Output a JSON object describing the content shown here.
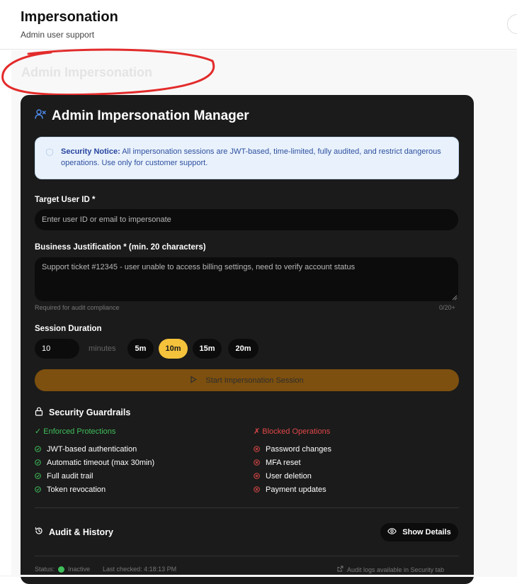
{
  "header": {
    "title": "Impersonation",
    "subtitle": "Admin user support"
  },
  "main": {
    "section_title": "Admin Impersonation"
  },
  "card": {
    "title": "Admin Impersonation Manager",
    "notice": {
      "label": "Security Notice:",
      "text": "All impersonation sessions are JWT-based, time-limited, fully audited, and restrict dangerous operations. Use only for customer support."
    },
    "target": {
      "label": "Target User ID *",
      "placeholder": "Enter user ID or email to impersonate",
      "value": ""
    },
    "justification": {
      "label": "Business Justification * (min. 20 characters)",
      "placeholder": "Support ticket #12345 - user unable to access billing settings, need to verify account status",
      "value": "",
      "hint": "Required for audit compliance",
      "counter": "0/20+"
    },
    "duration": {
      "label": "Session Duration",
      "value": "10",
      "unit": "minutes",
      "options": [
        "5m",
        "10m",
        "15m",
        "20m"
      ],
      "selected": "10m"
    },
    "start_button": "Start Impersonation Session",
    "guardrails": {
      "title": "Security Guardrails",
      "enforced_title": "✓ Enforced Protections",
      "enforced": [
        "JWT-based authentication",
        "Automatic timeout (max 30min)",
        "Full audit trail",
        "Token revocation"
      ],
      "blocked_title": "✗ Blocked Operations",
      "blocked": [
        "Password changes",
        "MFA reset",
        "User deletion",
        "Payment updates"
      ]
    },
    "audit": {
      "title": "Audit & History",
      "show_details": "Show Details"
    },
    "footer": {
      "status_label": "Status:",
      "status_value": "Inactive",
      "last_checked": "Last checked: 4:18:13 PM",
      "audit_link": "Audit logs available in Security tab"
    }
  },
  "colors": {
    "accent": "#f4c23b",
    "start_button": "#7d500f",
    "enforced": "#3fbf5b",
    "blocked": "#e04848",
    "notice_bg": "#e9f2fc",
    "card_bg": "#1b1b1b"
  }
}
